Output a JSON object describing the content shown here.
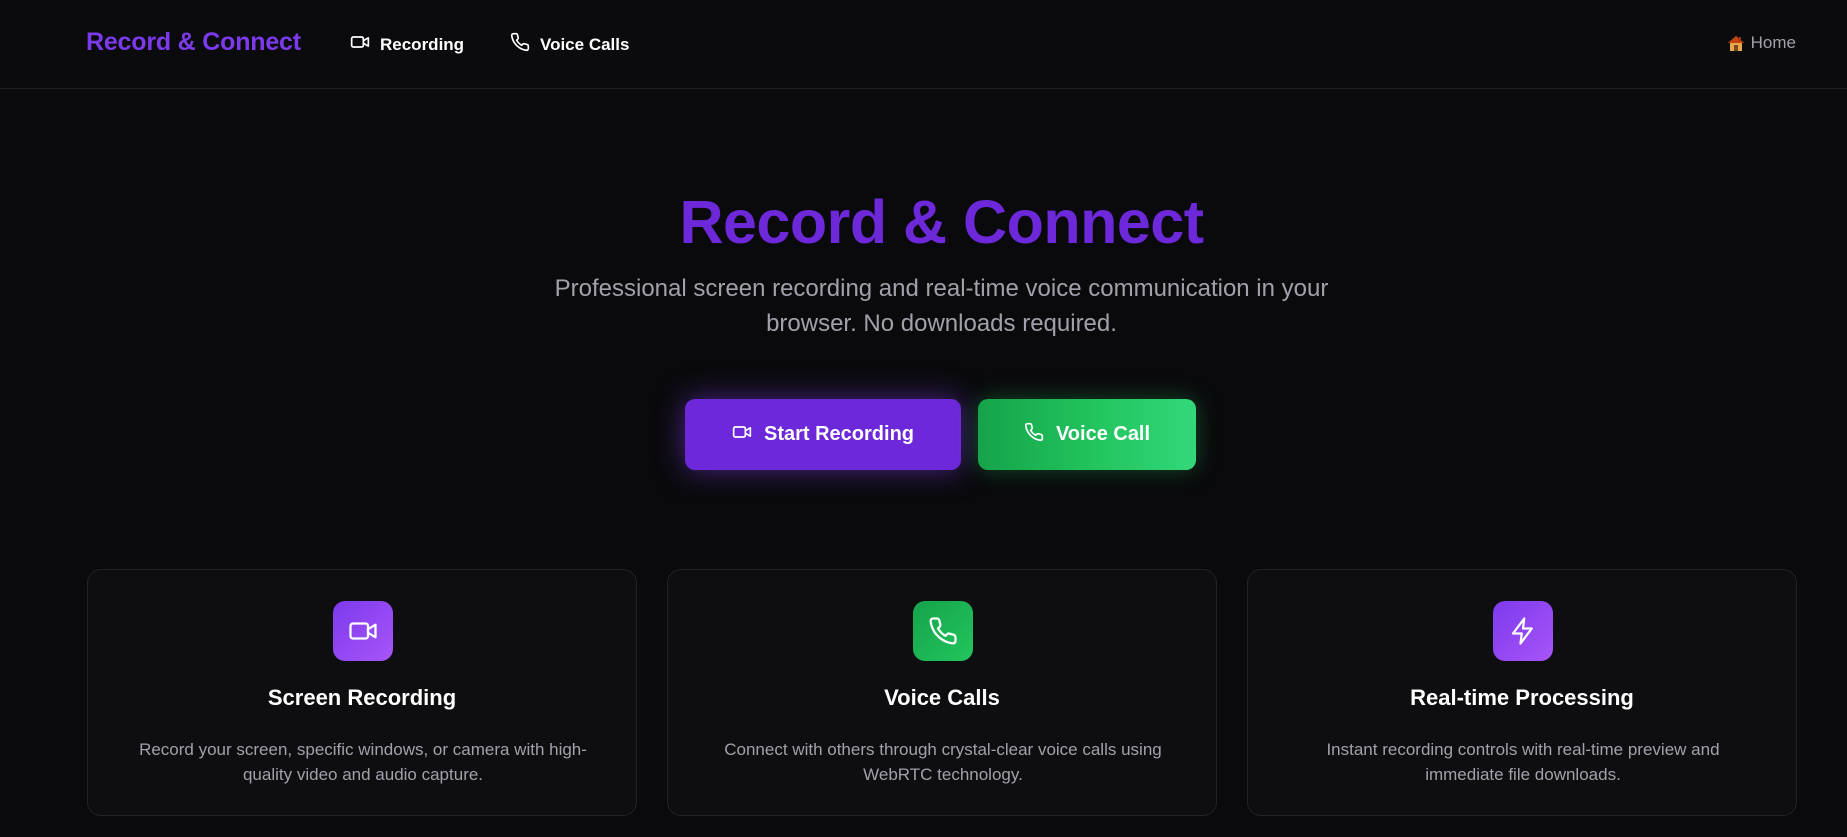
{
  "nav": {
    "brand": "Record & Connect",
    "links": [
      {
        "label": "Recording",
        "icon": "video-camera-icon"
      },
      {
        "label": "Voice Calls",
        "icon": "phone-icon"
      }
    ],
    "home_label": "Home",
    "home_icon": "house-icon"
  },
  "hero": {
    "title": "Record & Connect",
    "subtitle": "Professional screen recording and real-time voice communication in your browser. No downloads required.",
    "primary_button": "Start Recording",
    "secondary_button": "Voice Call"
  },
  "features": [
    {
      "icon": "video-camera-icon",
      "title": "Screen Recording",
      "description": "Record your screen, specific windows, or camera with high-quality video and audio capture."
    },
    {
      "icon": "phone-icon",
      "title": "Voice Calls",
      "description": "Connect with others through crystal-clear voice calls using WebRTC technology."
    },
    {
      "icon": "lightning-bolt-icon",
      "title": "Real-time Processing",
      "description": "Instant recording controls with real-time preview and immediate file downloads."
    }
  ],
  "colors": {
    "accent_purple": "#6d28d9",
    "accent_green": "#22c55e",
    "background": "#0a0a0c",
    "muted_text": "#a1a1aa"
  }
}
